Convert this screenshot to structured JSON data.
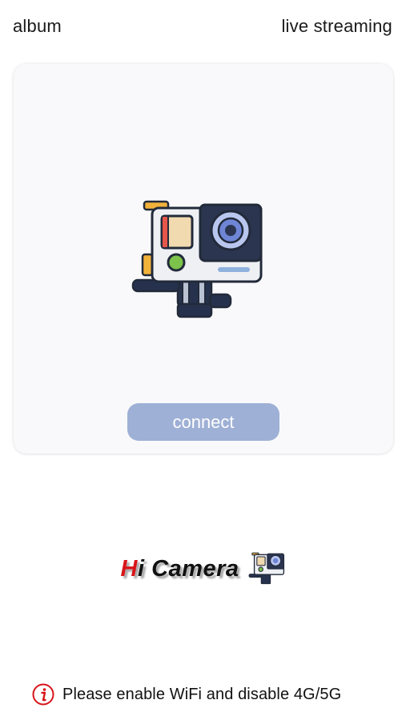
{
  "header": {
    "left_link": "album",
    "right_link": "live streaming"
  },
  "main_card": {
    "illustration": "action-camera-icon",
    "connect_label": "connect",
    "connect_color": "#9fb0d6"
  },
  "brand": {
    "h": "H",
    "rest": "i Camera",
    "icon": "action-camera-icon",
    "accent": "#d8141a"
  },
  "notice": {
    "icon": "info-icon",
    "text": "Please enable WiFi and disable 4G/5G",
    "icon_color": "#d8141a"
  }
}
